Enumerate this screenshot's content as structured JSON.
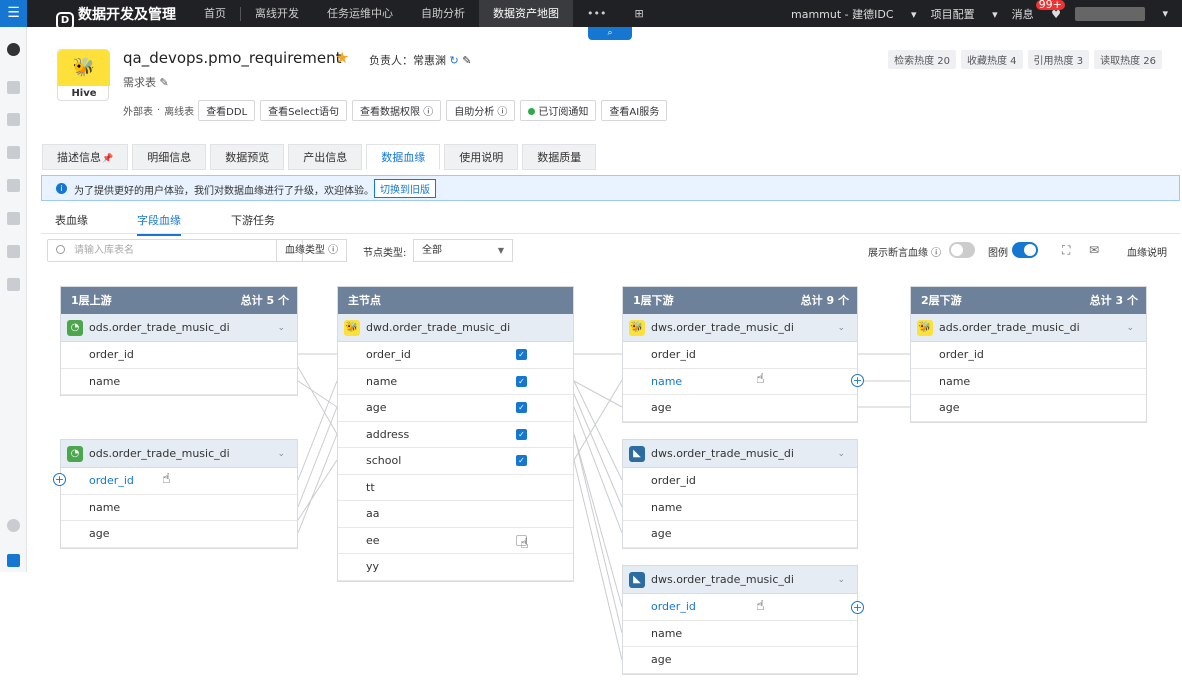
{
  "topbar": {
    "brand": "数据开发及管理",
    "nav": [
      "首页",
      "离线开发",
      "任务运维中心",
      "自助分析",
      "数据资产地图"
    ],
    "active_nav": 4,
    "more": "•••",
    "user_site": "mammut - 建德IDC",
    "project": "项目配置",
    "messages": "消息",
    "msg_badge": "99+",
    "search_icon": "search-icon"
  },
  "table": {
    "name": "qa_devops.pmo_requirement",
    "source": "Hive",
    "owner_label": "负责人：常惠渊",
    "desc": "需求表",
    "type_external": "外部表",
    "type_offline": "离线表",
    "actions": [
      "查看DDL",
      "查看Select语句",
      "查看数据权限",
      "自助分析",
      "已订阅通知",
      "查看AI服务"
    ],
    "heat": [
      "检索热度 20",
      "收藏热度 4",
      "引用热度 3",
      "读取热度 26"
    ]
  },
  "tabs": [
    "描述信息",
    "明细信息",
    "数据预览",
    "产出信息",
    "数据血缘",
    "使用说明",
    "数据质量"
  ],
  "active_tab": 4,
  "notice": {
    "text": "为了提供更好的用户体验，我们对数据血缘进行了升级，欢迎体验。",
    "button": "切换到旧版"
  },
  "subtabs": [
    "表血缘",
    "字段血缘",
    "下游任务"
  ],
  "active_subtab": 1,
  "filter": {
    "search_placeholder": "请输入库表名",
    "lineage_type": "血缘类型",
    "node_type_label": "节点类型:",
    "node_type_value": "全部",
    "show_assert": "展示断言血缘",
    "legend": "图例",
    "help": "血缘说明"
  },
  "lineage": {
    "upstream1": {
      "title": "1层上游",
      "total": "总计 5 个",
      "tables": [
        {
          "name": "ods.order_trade_music_di",
          "fields": [
            "order_id",
            "name"
          ],
          "highlight": -1
        },
        {
          "name": "ods.order_trade_music_di",
          "fields": [
            "order_id",
            "name",
            "age"
          ],
          "highlight": 0
        }
      ]
    },
    "main": {
      "title": "主节点",
      "table": "dwd.order_trade_music_di",
      "fields": [
        "order_id",
        "name",
        "age",
        "address",
        "school",
        "tt",
        "aa",
        "ee",
        "yy"
      ],
      "checked": [
        true,
        true,
        true,
        true,
        true,
        false,
        false,
        false,
        false
      ],
      "checkbox_shown": [
        true,
        true,
        true,
        true,
        true,
        false,
        false,
        true,
        false
      ]
    },
    "downstream1": {
      "title": "1层下游",
      "total": "总计 9 个",
      "tables": [
        {
          "name": "dws.order_trade_music_di",
          "icon": "hive",
          "fields": [
            "order_id",
            "name",
            "age"
          ],
          "highlight": 1
        },
        {
          "name": "dws.order_trade_music_di",
          "icon": "mysql",
          "fields": [
            "order_id",
            "name",
            "age"
          ],
          "highlight": -1
        },
        {
          "name": "dws.order_trade_music_di",
          "icon": "mysql",
          "fields": [
            "order_id",
            "name",
            "age"
          ],
          "highlight": 0
        }
      ]
    },
    "downstream2": {
      "title": "2层下游",
      "total": "总计 3 个",
      "tables": [
        {
          "name": "ads.order_trade_music_di",
          "fields": [
            "order_id",
            "name",
            "age"
          ],
          "highlight": -1
        }
      ]
    }
  }
}
